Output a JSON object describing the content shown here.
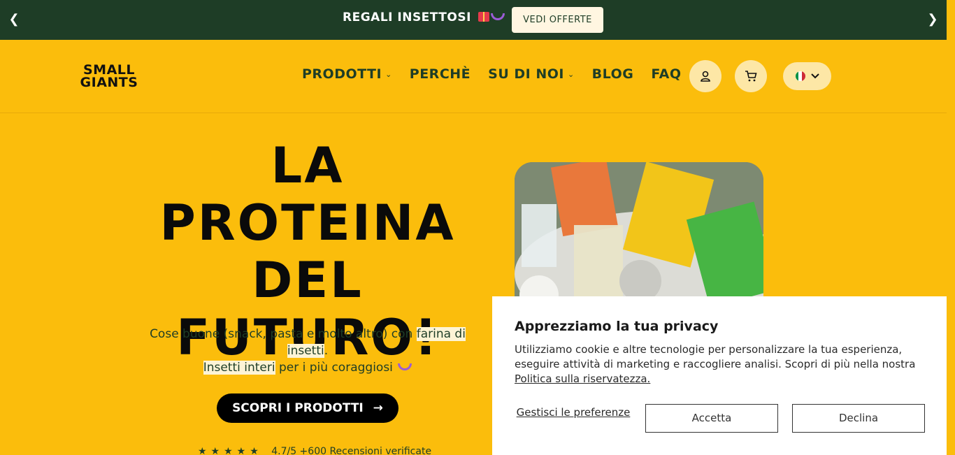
{
  "announcement": {
    "text": "REGALI INSETTOSI",
    "cta_label": "VEDI OFFERTE",
    "prev_icon": "chevron-left-icon",
    "next_icon": "chevron-right-icon"
  },
  "header": {
    "logo_line1": "SMALL",
    "logo_line2": "GIANTS",
    "nav": [
      {
        "label": "PRODOTTI",
        "has_dropdown": true
      },
      {
        "label": "PERCHÈ",
        "has_dropdown": false
      },
      {
        "label": "SU DI NOI",
        "has_dropdown": true
      },
      {
        "label": "BLOG",
        "has_dropdown": false
      },
      {
        "label": "FAQ",
        "has_dropdown": false
      }
    ],
    "account_icon": "user-icon",
    "cart_icon": "cart-icon",
    "language_icon": "italy-flag-icon"
  },
  "hero": {
    "title_line1": "LA",
    "title_line2": "PROTEINA",
    "title_line3": "DEL FUTURO!",
    "sub_part1": "Cose buone (snack, pasta e molto altro) con ",
    "sub_highlight1": "farina di insetti",
    "sub_part2": ".",
    "sub_highlight2": "Insetti interi",
    "sub_part3": " per i più coraggiosi",
    "cta_label": "SCOPRI I PRODOTTI",
    "rating_text": "4.7/5 +600 Recensioni verificate"
  },
  "cookie": {
    "title": "Apprezziamo la tua privacy",
    "body": "Utilizziamo cookie e altre tecnologie per personalizzare la tua esperienza, eseguire attività di marketing e raccogliere analisi. Scopri di più nella nostra ",
    "link": "Politica sulla riservatezza.",
    "manage_label": "Gestisci le preferenze",
    "accept_label": "Accetta",
    "decline_label": "Declina"
  },
  "colors": {
    "background": "#fbbd0c",
    "announcement_bg": "#1e3d26",
    "nav_text": "#1e3d26"
  }
}
